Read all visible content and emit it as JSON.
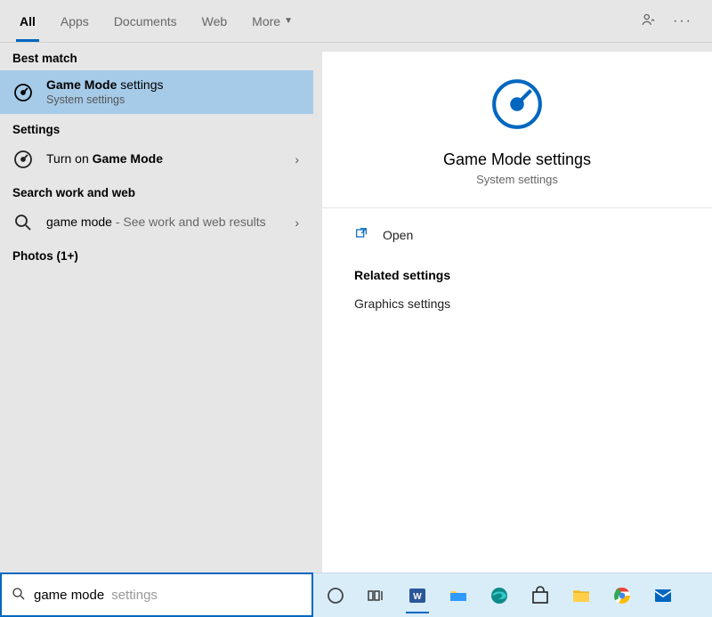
{
  "tabs": {
    "items": [
      {
        "label": "All",
        "active": true
      },
      {
        "label": "Apps",
        "active": false
      },
      {
        "label": "Documents",
        "active": false
      },
      {
        "label": "Web",
        "active": false
      },
      {
        "label": "More",
        "active": false,
        "dropdown": true
      }
    ]
  },
  "sections": {
    "best_match": "Best match",
    "settings": "Settings",
    "search_web": "Search work and web",
    "photos": "Photos (1+)"
  },
  "best_match_result": {
    "title_bold": "Game Mode",
    "title_rest": " settings",
    "sub": "System settings"
  },
  "settings_result": {
    "prefix": "Turn on ",
    "bold": "Game Mode"
  },
  "web_result": {
    "term": "game mode",
    "suffix": " - See work and web results"
  },
  "preview": {
    "title": "Game Mode settings",
    "sub": "System settings",
    "open_label": "Open",
    "related_header": "Related settings",
    "related_items": [
      "Graphics settings"
    ]
  },
  "search": {
    "typed": "game mode",
    "hint": " settings"
  },
  "colors": {
    "accent": "#0067c0",
    "selected": "#a6cbe9"
  }
}
